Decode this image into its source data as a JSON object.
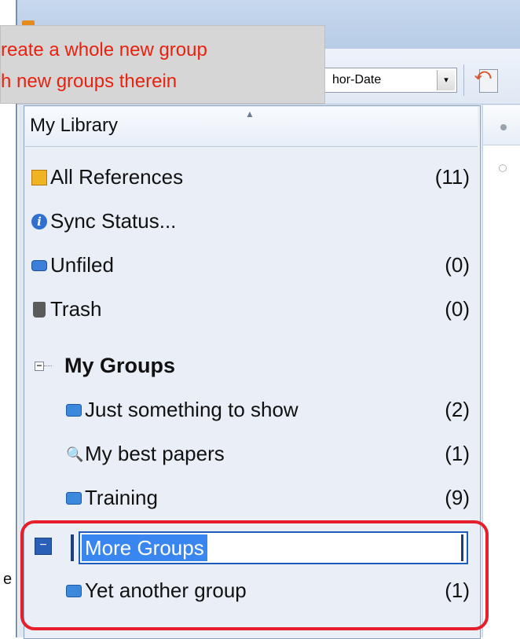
{
  "tooltip": {
    "line1": "reate a whole new group",
    "line2": "h new groups therein"
  },
  "toolbar": {
    "sort_value": "hor-Date",
    "sort_arrow": "▾"
  },
  "library": {
    "header": "My Library"
  },
  "items": [
    {
      "label": "All References",
      "count": "(11)",
      "icon": "all-references-icon"
    },
    {
      "label": "Sync Status...",
      "count": "",
      "icon": "info-icon"
    },
    {
      "label": "Unfiled",
      "count": "(0)",
      "icon": "unfiled-icon"
    },
    {
      "label": "Trash",
      "count": "(0)",
      "icon": "trash-icon"
    }
  ],
  "my_groups": {
    "label": "My Groups",
    "expander": "−",
    "groups": [
      {
        "label": "Just something to show",
        "count": "(2)",
        "icon": "folder-icon"
      },
      {
        "label": "My best papers",
        "count": "(1)",
        "icon": "smart-group-icon"
      },
      {
        "label": "Training",
        "count": "(9)",
        "icon": "folder-icon"
      }
    ]
  },
  "more_groups": {
    "edit_value": "More Groups",
    "expander": "−",
    "groups": [
      {
        "label": "Yet another group",
        "count": "(1)",
        "icon": "folder-icon"
      }
    ]
  },
  "stray_char": "e",
  "colors": {
    "tooltip_text": "#e8220f",
    "highlight_border": "#e5202a",
    "selection": "#3a86f0",
    "panel_bg": "#e9eef7"
  }
}
